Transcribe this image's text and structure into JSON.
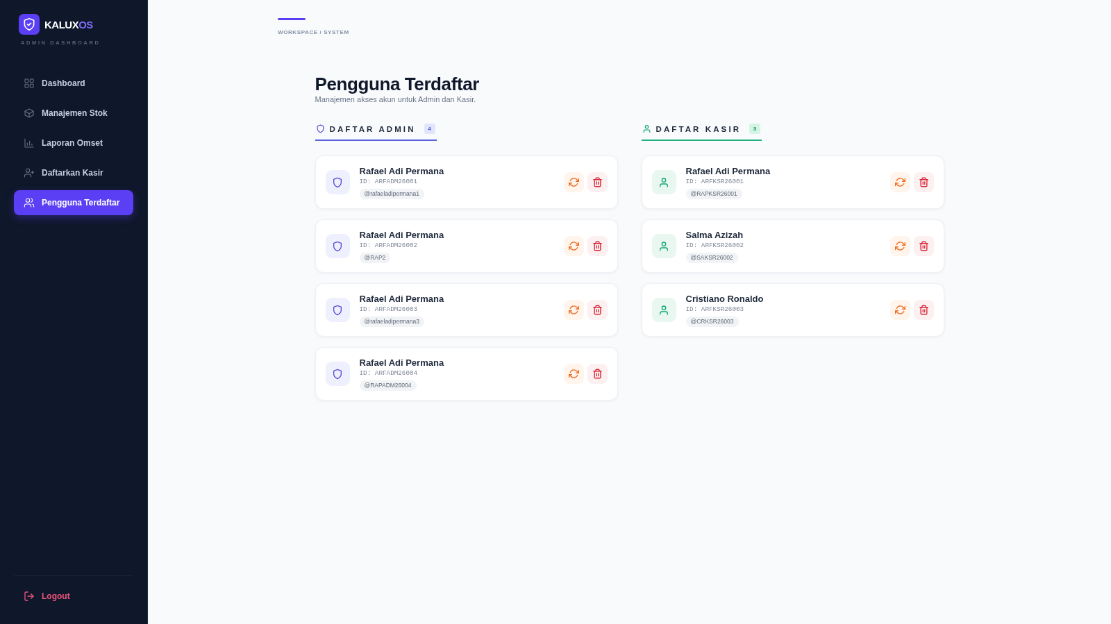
{
  "sidebar": {
    "brand": {
      "name": "KALUX",
      "accent": "OS",
      "subtitle": "ADMIN DASHBOARD"
    },
    "items": [
      {
        "label": "Dashboard",
        "selected": false
      },
      {
        "label": "Manajemen Stok",
        "selected": false
      },
      {
        "label": "Laporan Omset",
        "selected": false
      },
      {
        "label": "Daftarkan Kasir",
        "selected": false
      },
      {
        "label": "Pengguna Terdaftar",
        "selected": true
      }
    ],
    "logout": {
      "label": "Logout"
    }
  },
  "breadcrumb": "WORKSPACE / SYSTEM",
  "page": {
    "title": "Pengguna Terdaftar",
    "subtitle": "Manajemen akses akun untuk Admin dan Kasir."
  },
  "sections": [
    {
      "kind": "admin",
      "title": "DAFTAR ADMIN",
      "count": "4",
      "users": [
        {
          "name": "Rafael Adi Permana",
          "id": "ID: ARFADM26001",
          "handle": "@rafaeladipermana1"
        },
        {
          "name": "Rafael Adi Permana",
          "id": "ID: ARFADM26002",
          "handle": "@RAP2"
        },
        {
          "name": "Rafael Adi Permana",
          "id": "ID: ARFADM26003",
          "handle": "@rafaeladipermana3"
        },
        {
          "name": "Rafael Adi Permana",
          "id": "ID: ARFADM26004",
          "handle": "@RAPADM26004"
        }
      ]
    },
    {
      "kind": "cashier",
      "title": "DAFTAR KASIR",
      "count": "3",
      "users": [
        {
          "name": "Rafael Adi Permana",
          "id": "ID: ARFKSR26001",
          "handle": "@RAPKSR26001"
        },
        {
          "name": "Salma Azizah",
          "id": "ID: ARFKSR26002",
          "handle": "@SAKSR26002"
        },
        {
          "name": "Cristiano Ronaldo",
          "id": "ID: ARFKSR26003",
          "handle": "@CRKSR26003"
        }
      ]
    }
  ]
}
